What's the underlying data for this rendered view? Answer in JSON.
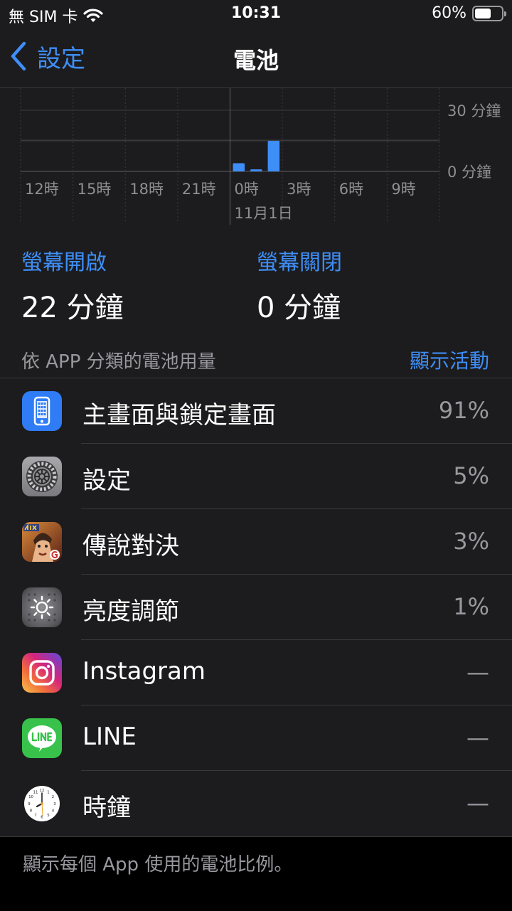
{
  "status_bar": {
    "carrier": "無 SIM 卡",
    "time": "10:31",
    "battery": "60%",
    "battery_level": 0.6
  },
  "nav": {
    "back_label": "設定",
    "title": "電池"
  },
  "chart_data": {
    "type": "bar",
    "x_tick_labels": [
      "12時",
      "15時",
      "18時",
      "21時",
      "0時",
      "3時",
      "6時",
      "9時"
    ],
    "date_label": "11月1日",
    "y_tick_labels": [
      "30 分鐘",
      "0 分鐘"
    ],
    "ylim": [
      0,
      30
    ],
    "bar_start_hours": [
      0,
      1,
      2
    ],
    "values": [
      4,
      1,
      15
    ],
    "grid": true
  },
  "summary": {
    "screen_on_label": "螢幕開啟",
    "screen_on_value": "22 分鐘",
    "screen_off_label": "螢幕關閉",
    "screen_off_value": "0 分鐘"
  },
  "section": {
    "title": "依 APP 分類的電池用量",
    "action": "顯示活動"
  },
  "apps": [
    {
      "name": "主畫面與鎖定畫面",
      "percent": "91%",
      "icon": "home-lock-screen-icon"
    },
    {
      "name": "設定",
      "percent": "5%",
      "icon": "settings-gear-icon"
    },
    {
      "name": "傳說對決",
      "percent": "3%",
      "icon": "game-icon"
    },
    {
      "name": "亮度調節",
      "percent": "1%",
      "icon": "brightness-icon"
    },
    {
      "name": "Instagram",
      "percent": "—",
      "icon": "instagram-icon"
    },
    {
      "name": "LINE",
      "percent": "—",
      "icon": "line-icon"
    },
    {
      "name": "時鐘",
      "percent": "—",
      "icon": "clock-icon"
    }
  ],
  "footer": {
    "text": "顯示每個 App 使用的電池比例。"
  }
}
